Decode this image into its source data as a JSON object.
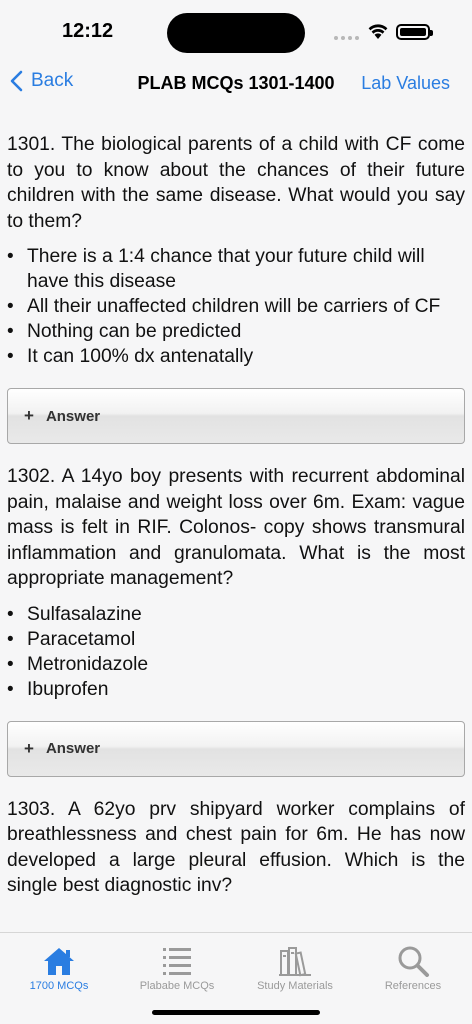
{
  "status": {
    "time": "12:12"
  },
  "nav": {
    "back_label": "Back",
    "title": "PLAB MCQs 1301-1400",
    "right_label": "Lab Values"
  },
  "questions": [
    {
      "text": "1301. The biological parents of a child with CF come to you to know about the chances of their future children with the same disease. What would you say to them?",
      "options": [
        "There is a 1:4 chance that your future child will have this disease",
        "All their unaffected children will be carriers of CF",
        "Nothing can be predicted",
        "It can 100% dx antenatally"
      ],
      "answer_label": "Answer"
    },
    {
      "text": "1302. A 14yo boy presents with recurrent abdominal pain, malaise and weight loss over 6m. Exam: vague mass is felt in RIF. Colonos- copy shows transmural inflammation and granulomata. What is the most appropriate management?",
      "options": [
        "Sulfasalazine",
        "Paracetamol",
        "Metronidazole",
        "Ibuprofen"
      ],
      "answer_label": "Answer"
    },
    {
      "text": "1303. A 62yo prv shipyard worker complains of breathlessness and chest pain for 6m. He has now developed a large pleural effusion. Which is the single best diagnostic inv?"
    }
  ],
  "tabs": [
    {
      "label": "1700 MCQs",
      "icon": "home-icon",
      "active": true
    },
    {
      "label": "Plababe MCQs",
      "icon": "list-icon",
      "active": false
    },
    {
      "label": "Study Materials",
      "icon": "books-icon",
      "active": false
    },
    {
      "label": "References",
      "icon": "search-icon",
      "active": false
    }
  ],
  "colors": {
    "accent": "#2a7de1",
    "inactive": "#9a9a9a",
    "background": "#f6f6f7"
  }
}
